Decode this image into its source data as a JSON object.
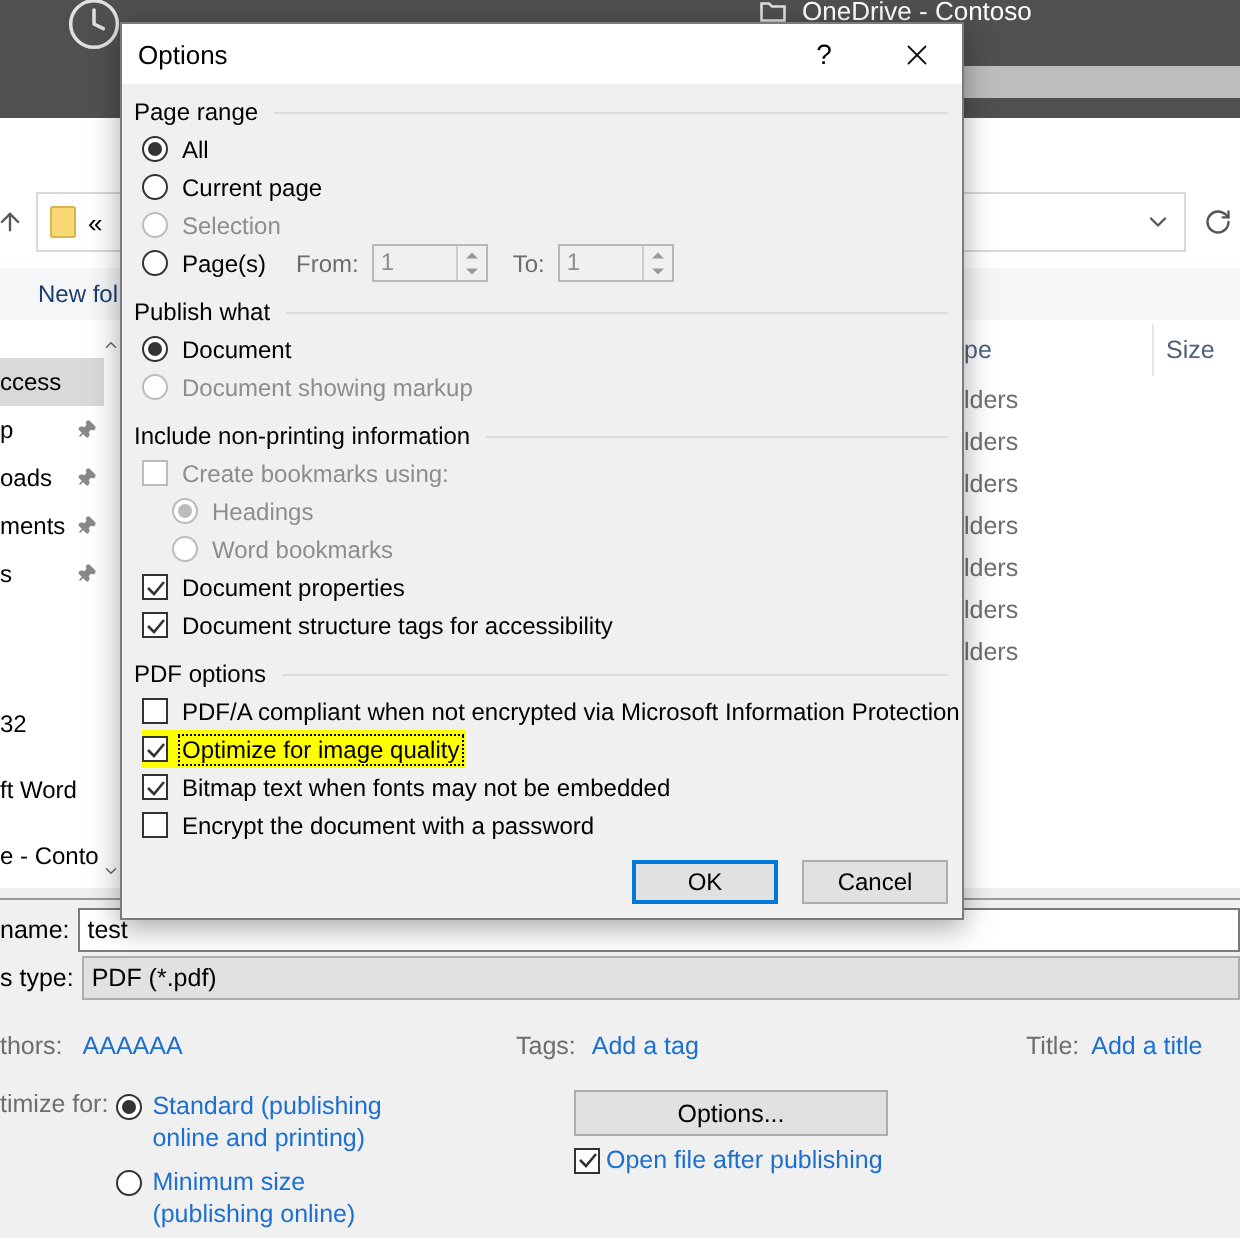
{
  "background_window": {
    "header": {
      "location": "OneDrive - Contoso"
    },
    "address_bar": {
      "separator": "«"
    },
    "toolbar": {
      "new_folder": "New fol"
    },
    "nav_groups": [
      {
        "items": [
          {
            "label": "ccess",
            "selected": true,
            "pinned": false
          },
          {
            "label": "p",
            "selected": false,
            "pinned": true
          },
          {
            "label": "oads",
            "selected": false,
            "pinned": true
          },
          {
            "label": "ments",
            "selected": false,
            "pinned": true
          },
          {
            "label": "s",
            "selected": false,
            "pinned": true
          }
        ]
      },
      {
        "items": [
          {
            "label": "32",
            "selected": false,
            "pinned": false
          },
          {
            "label": "ft Word",
            "selected": false,
            "pinned": false
          },
          {
            "label": "e - Conto",
            "selected": false,
            "pinned": false
          }
        ]
      }
    ],
    "file_list": {
      "columns": [
        "pe",
        "Size"
      ],
      "rows": [
        "lders",
        "lders",
        "lders",
        "lders",
        "lders",
        "lders",
        "lders"
      ]
    },
    "file_name": {
      "label": "name:",
      "value": "test"
    },
    "save_type": {
      "label": "s type:",
      "value": "PDF (*.pdf)"
    },
    "meta": [
      {
        "label": "thors:",
        "value": "AAAAAA"
      },
      {
        "label": "Tags:",
        "value": "Add a tag"
      },
      {
        "label": "Title:",
        "value": "Add a title"
      }
    ],
    "optimize": {
      "label": "timize for:",
      "options": [
        {
          "label": "Standard (publishing online and printing)",
          "selected": true
        },
        {
          "label": "Minimum size (publishing online)",
          "selected": false
        }
      ]
    },
    "options_button": "Options...",
    "open_after": {
      "label": "Open file after publishing",
      "checked": true
    }
  },
  "dialog": {
    "title": "Options",
    "help": "?",
    "sections": [
      {
        "heading": "Page range",
        "items": [
          {
            "kind": "radio",
            "label": "All",
            "selected": true,
            "disabled": false
          },
          {
            "kind": "radio",
            "label": "Current page",
            "selected": false,
            "disabled": false
          },
          {
            "kind": "radio",
            "label": "Selection",
            "selected": false,
            "disabled": true
          },
          {
            "kind": "range",
            "label": "Page(s)",
            "selected": false,
            "disabled": false,
            "from_label": "From:",
            "from_value": "1",
            "to_label": "To:",
            "to_value": "1"
          }
        ]
      },
      {
        "heading": "Publish what",
        "items": [
          {
            "kind": "radio",
            "label": "Document",
            "selected": true,
            "disabled": false
          },
          {
            "kind": "radio",
            "label": "Document showing markup",
            "selected": false,
            "disabled": true
          }
        ]
      },
      {
        "heading": "Include non-printing information",
        "items": [
          {
            "kind": "checkbox",
            "label": "Create bookmarks using:",
            "checked": false,
            "disabled": true,
            "children": [
              {
                "kind": "radio",
                "label": "Headings",
                "selected": true,
                "disabled": true
              },
              {
                "kind": "radio",
                "label": "Word bookmarks",
                "selected": false,
                "disabled": true
              }
            ]
          },
          {
            "kind": "checkbox",
            "label": "Document properties",
            "checked": true,
            "disabled": false
          },
          {
            "kind": "checkbox",
            "label": "Document structure tags for accessibility",
            "checked": true,
            "disabled": false
          }
        ]
      },
      {
        "heading": "PDF options",
        "items": [
          {
            "kind": "checkbox",
            "label": "PDF/A compliant when not encrypted via Microsoft Information Protection",
            "checked": false,
            "disabled": false,
            "highlighted": false,
            "focused": false
          },
          {
            "kind": "checkbox",
            "label": "Optimize for image quality",
            "checked": true,
            "disabled": false,
            "highlighted": true,
            "focused": true
          },
          {
            "kind": "checkbox",
            "label": "Bitmap text when fonts may not be embedded",
            "checked": true,
            "disabled": false,
            "highlighted": false,
            "focused": false
          },
          {
            "kind": "checkbox",
            "label": "Encrypt the document with a password",
            "checked": false,
            "disabled": false,
            "highlighted": false,
            "focused": false
          }
        ]
      }
    ],
    "buttons": [
      {
        "label": "OK",
        "default": true
      },
      {
        "label": "Cancel",
        "default": false
      }
    ]
  }
}
